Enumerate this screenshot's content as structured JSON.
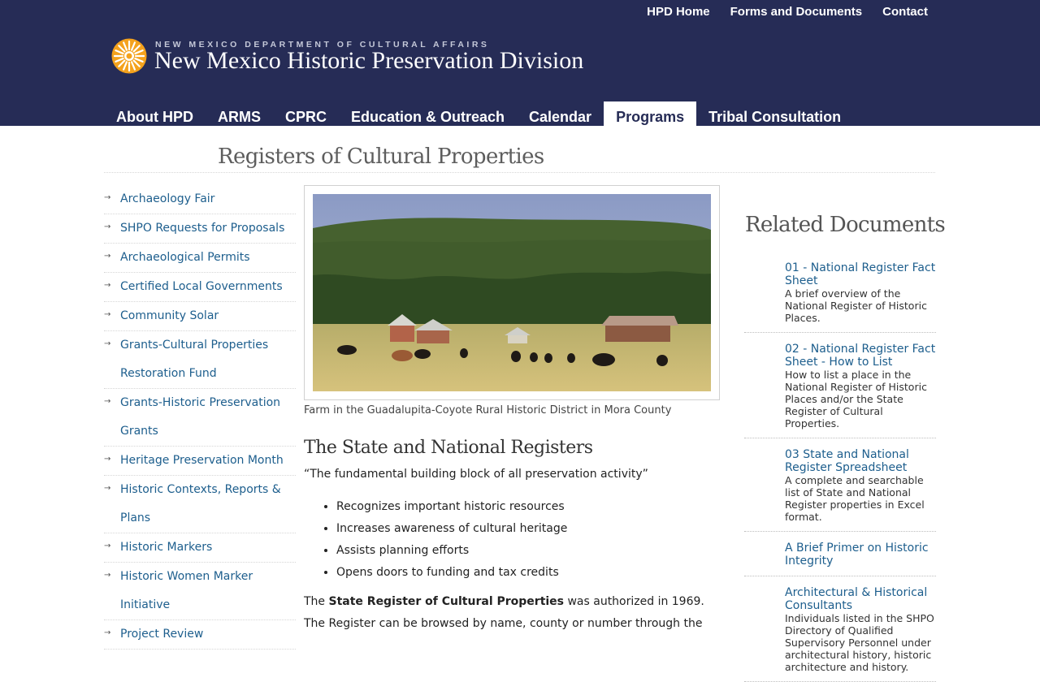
{
  "header": {
    "top_links": [
      "HPD Home",
      "Forms and Documents",
      "Contact"
    ],
    "agency": "NEW MEXICO DEPARTMENT OF CULTURAL AFFAIRS",
    "site_title": "New Mexico Historic Preservation Division",
    "logo_icon": "zia-sun-logo-icon",
    "nav_tabs": [
      {
        "label": "About HPD"
      },
      {
        "label": "ARMS"
      },
      {
        "label": "CPRC"
      },
      {
        "label": "Education & Outreach"
      },
      {
        "label": "Calendar"
      },
      {
        "label": "Programs",
        "active": true
      },
      {
        "label": "Tribal Consultation"
      }
    ]
  },
  "page": {
    "title": "Registers of Cultural Properties"
  },
  "sidebar": {
    "items": [
      {
        "label": "Archaeology Fair"
      },
      {
        "label": "SHPO Requests for Proposals"
      },
      {
        "label": "Archaeological Permits"
      },
      {
        "label": "Certified Local Governments"
      },
      {
        "label": "Community Solar"
      },
      {
        "label": "Grants-Cultural Properties Restoration Fund"
      },
      {
        "label": "Grants-Historic Preservation Grants"
      },
      {
        "label": "Heritage Preservation Month"
      },
      {
        "label": "Historic Contexts, Reports & Plans"
      },
      {
        "label": "Historic Markers"
      },
      {
        "label": "Historic Women Marker Initiative"
      },
      {
        "label": "Project Review"
      }
    ]
  },
  "main": {
    "photo_caption": "Farm in the Guadalupita-Coyote Rural Historic District in Mora County",
    "section_heading": "The State and National Registers",
    "quote": "“The fundamental building block of all preservation activity”",
    "bullets": [
      "Recognizes important historic resources",
      "Increases awareness of cultural heritage",
      "Assists planning efforts",
      "Opens doors to funding and tax credits"
    ],
    "para_before": "The ",
    "para_bold": "State Register of Cultural Properties",
    "para_after": " was authorized in 1969. The Register can be browsed by name, county or number through the"
  },
  "related": {
    "title": "Related Documents",
    "docs": [
      {
        "title": "01 - National Register Fact Sheet",
        "desc": "A brief overview of the National Register of Historic Places."
      },
      {
        "title": "02 - National Register Fact Sheet - How to List",
        "desc": "How to list a place in the National Register of Historic Places and/or the State Register of Cultural Properties."
      },
      {
        "title": "03 State and National Register Spreadsheet",
        "desc": "A complete and searchable list of State and National Register properties in Excel format."
      },
      {
        "title": "A Brief Primer on Historic Integrity",
        "desc": ""
      },
      {
        "title": "Architectural & Historical Consultants",
        "desc": "Individuals listed in the SHPO Directory of Qualified Supervisory Personnel under architectural history, historic architecture and history."
      }
    ]
  },
  "colors": {
    "header_bg": "#262c56",
    "link": "#1d5e8d",
    "logo_orange": "#f4a21d"
  }
}
